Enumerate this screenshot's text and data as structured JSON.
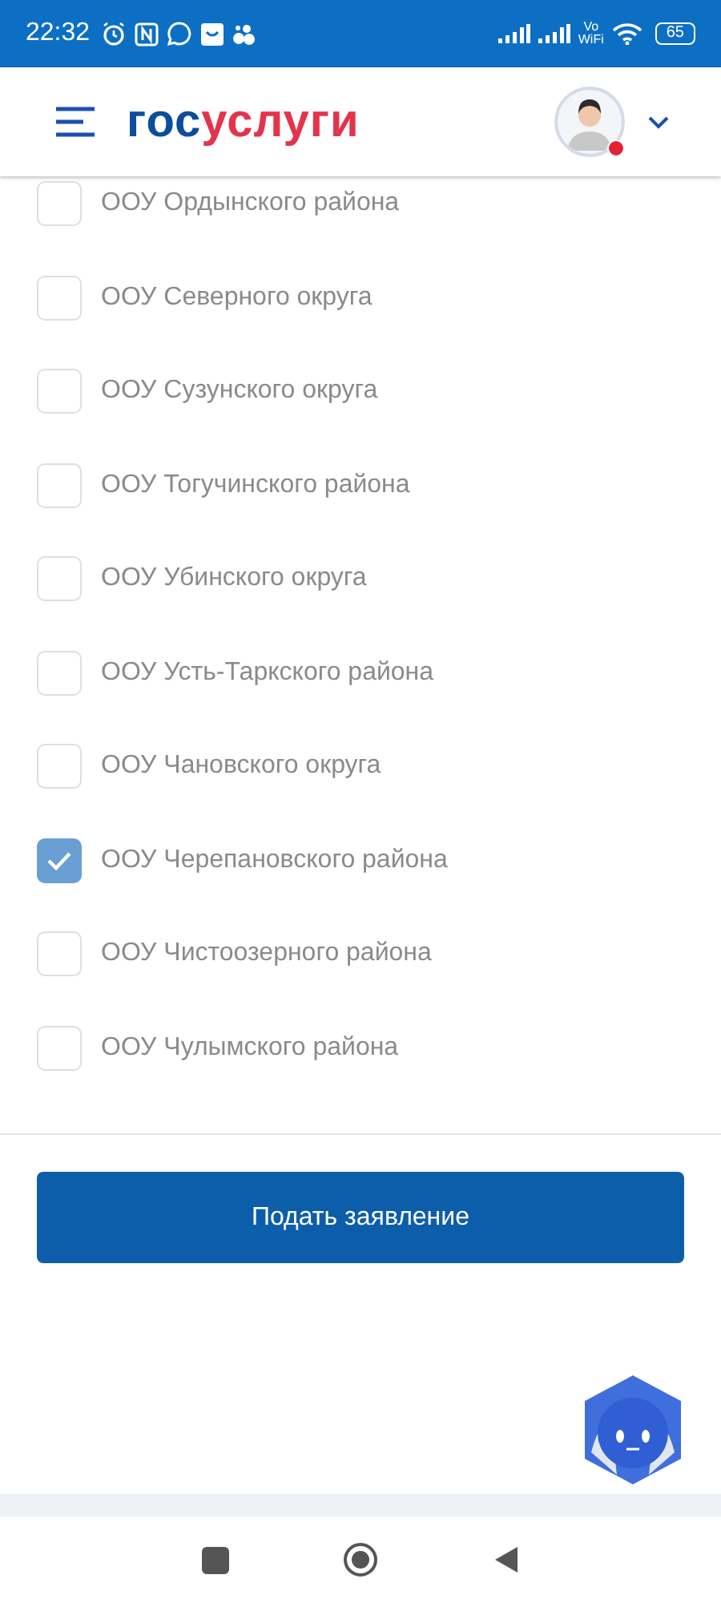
{
  "status_bar": {
    "time": "22:32",
    "vowifi_top": "Vo",
    "vowifi_bottom": "WiFi",
    "battery": "65"
  },
  "header": {
    "logo_prefix": "гос",
    "logo_suffix": "услуги",
    "notification": true
  },
  "options": [
    {
      "label": "ООУ Ордынского района",
      "checked": false
    },
    {
      "label": "ООУ Северного округа",
      "checked": false
    },
    {
      "label": "ООУ Сузунского округа",
      "checked": false
    },
    {
      "label": "ООУ Тогучинского района",
      "checked": false
    },
    {
      "label": "ООУ Убинского округа",
      "checked": false
    },
    {
      "label": "ООУ Усть-Таркского района",
      "checked": false
    },
    {
      "label": "ООУ Чановского округа",
      "checked": false
    },
    {
      "label": "ООУ Черепановского района",
      "checked": true
    },
    {
      "label": "ООУ Чистоозерного района",
      "checked": false
    },
    {
      "label": "ООУ Чулымского района",
      "checked": false
    }
  ],
  "submit_button": "Подать заявление"
}
